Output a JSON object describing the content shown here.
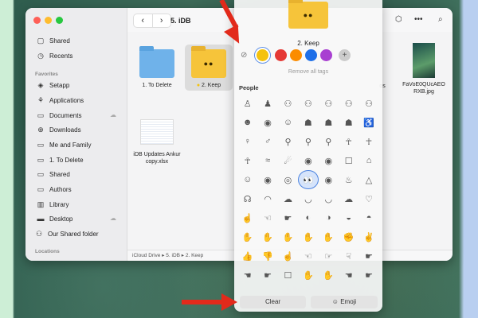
{
  "window": {
    "title": "5. iDB"
  },
  "sidebar": {
    "top": [
      {
        "label": "Shared",
        "icon": "shared-icon"
      },
      {
        "label": "Recents",
        "icon": "clock-icon"
      }
    ],
    "favorites_header": "Favorites",
    "favorites": [
      {
        "label": "Setapp",
        "icon": "setapp-icon"
      },
      {
        "label": "Applications",
        "icon": "applications-icon"
      },
      {
        "label": "Documents",
        "icon": "documents-icon"
      },
      {
        "label": "Downloads",
        "icon": "downloads-icon"
      },
      {
        "label": "Me and Family",
        "icon": "folder-icon"
      },
      {
        "label": "1. To Delete",
        "icon": "folder-icon"
      },
      {
        "label": "Shared",
        "icon": "folder-icon"
      },
      {
        "label": "Authors",
        "icon": "folder-icon"
      },
      {
        "label": "Library",
        "icon": "library-icon"
      },
      {
        "label": "Desktop",
        "icon": "desktop-icon"
      },
      {
        "label": "Our Shared folder",
        "icon": "group-folder-icon"
      }
    ],
    "locations_header": "Locations"
  },
  "files": [
    {
      "name": "1. To Delete"
    },
    {
      "name": "2. Keep"
    },
    {
      "name": "iDB Updates Ankur copy.xlsx"
    },
    {
      "name": "FaVoE0QUcAEO RXB.jpg"
    },
    {
      "name": "os"
    }
  ],
  "pathbar": "iCloud Drive ▸ 5. iDB ▸ 2. Keep",
  "popup": {
    "folder_name": "2. Keep",
    "remove_tags": "Remove all tags",
    "section": "People",
    "clear": "Clear",
    "emoji": "Emoji",
    "tag_colors": [
      "#f4c20d",
      "#e53935",
      "#fb8c00",
      "#1e6fe8",
      "#a83fd1"
    ],
    "symbols": [
      "♙",
      "♟",
      "⚇",
      "⚇",
      "⚇",
      "⚇",
      "⚇",
      "☻",
      "◉",
      "☺",
      "☗",
      "☗",
      "☗",
      "♿",
      "♀",
      "♂",
      "⚲",
      "⚲",
      "⚲",
      "☥",
      "☥",
      "☥",
      "≈",
      "☄",
      "◉",
      "◉",
      "☐",
      "⌂",
      "☺",
      "◉",
      "◎",
      "👀",
      "◉",
      "♨",
      "△",
      "☊",
      "◠",
      "☁",
      "◡",
      "◡",
      "☁",
      "♡",
      "☝",
      "☜",
      "☛",
      "◐",
      "◑",
      "◒",
      "◓",
      "✋",
      "✋",
      "✋",
      "✋",
      "✋",
      "✊",
      "✌",
      "👍",
      "👎",
      "☝",
      "☜",
      "☞",
      "☟",
      "☛",
      "☚",
      "☛",
      "☐",
      "✋",
      "✋",
      "☚",
      "☛"
    ]
  }
}
